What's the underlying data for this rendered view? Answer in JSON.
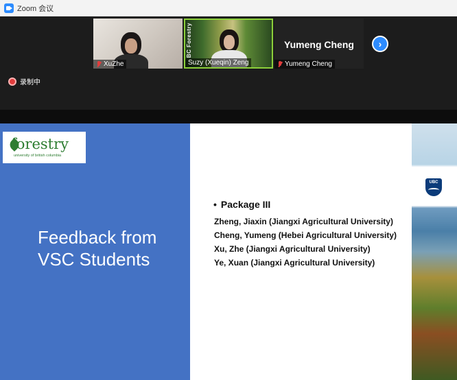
{
  "window": {
    "title": "Zoom 会议"
  },
  "participants": [
    {
      "name": "XuZhe",
      "muted": true
    },
    {
      "name": "Suzy (Xueqin) Zeng",
      "muted": false,
      "background_text": "BC Forestry"
    },
    {
      "name": "Yumeng Cheng",
      "muted": true,
      "display_name": "Yumeng Cheng"
    }
  ],
  "recording": {
    "label": "录制中"
  },
  "nav": {
    "next_icon": "chevron-right-icon",
    "next_glyph": "›"
  },
  "slide": {
    "logo_text": "forestry",
    "logo_subtext": "university of british columbia",
    "heading_line1": "Feedback from",
    "heading_line2": "VSC Students",
    "package_title": "Package III",
    "names": [
      "Zheng, Jiaxin (Jiangxi Agricultural University)",
      "Cheng, Yumeng (Hebei Agricultural University)",
      "Xu, Zhe (Jiangxi Agricultural University)",
      "Ye, Xuan (Jiangxi Agricultural University)"
    ],
    "crest_text": "UBC"
  },
  "colors": {
    "slide_blue": "#4472c4",
    "zoom_blue": "#2d8cff",
    "active_speaker": "#8ccf3a",
    "muted_red": "#e23c3c"
  }
}
